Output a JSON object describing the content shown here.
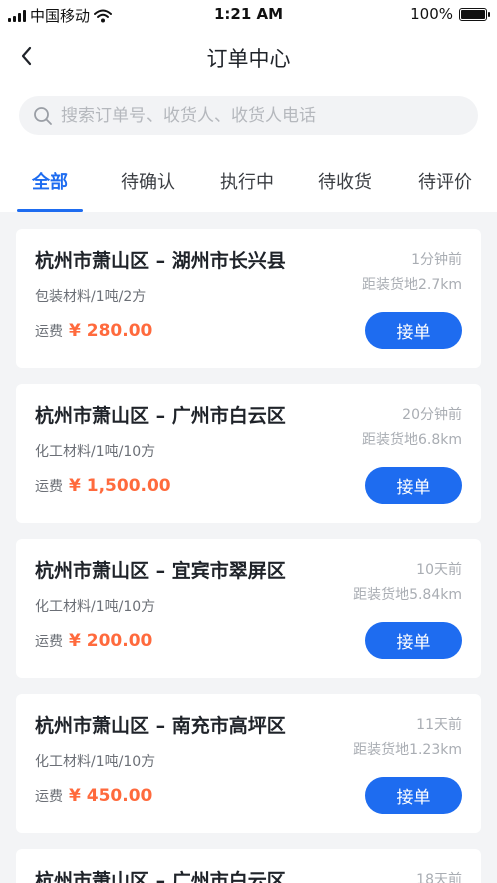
{
  "status_bar": {
    "carrier": "中国移动",
    "time": "1:21 AM",
    "battery": "100%",
    "battery_level": 1.0
  },
  "header": {
    "title": "订单中心"
  },
  "search": {
    "placeholder": "搜索订单号、收货人、收货人电话"
  },
  "tabs": [
    {
      "label": "全部",
      "active": true
    },
    {
      "label": "待确认",
      "active": false
    },
    {
      "label": "执行中",
      "active": false
    },
    {
      "label": "待收货",
      "active": false
    },
    {
      "label": "待评价",
      "active": false
    }
  ],
  "colors": {
    "accent": "#1e6cf0",
    "fee": "#ff6a3d"
  },
  "orders": [
    {
      "route": "杭州市萧山区 – 湖州市长兴县",
      "time": "1分钟前",
      "goods": "包装材料/1吨/2方",
      "distance": "距装货地2.7km",
      "fee_label": "运费",
      "fee": "¥ 280.00",
      "action": "接单"
    },
    {
      "route": "杭州市萧山区 – 广州市白云区",
      "time": "20分钟前",
      "goods": "化工材料/1吨/10方",
      "distance": "距装货地6.8km",
      "fee_label": "运费",
      "fee": "¥ 1,500.00",
      "action": "接单"
    },
    {
      "route": "杭州市萧山区 – 宜宾市翠屏区",
      "time": "10天前",
      "goods": "化工材料/1吨/10方",
      "distance": "距装货地5.84km",
      "fee_label": "运费",
      "fee": "¥ 200.00",
      "action": "接单"
    },
    {
      "route": "杭州市萧山区 – 南充市高坪区",
      "time": "11天前",
      "goods": "化工材料/1吨/10方",
      "distance": "距装货地1.23km",
      "fee_label": "运费",
      "fee": "¥ 450.00",
      "action": "接单"
    },
    {
      "route": "杭州市萧山区 – 广州市白云区",
      "time": "18天前",
      "goods": "",
      "distance": "",
      "fee_label": "",
      "fee": "",
      "action": ""
    }
  ]
}
